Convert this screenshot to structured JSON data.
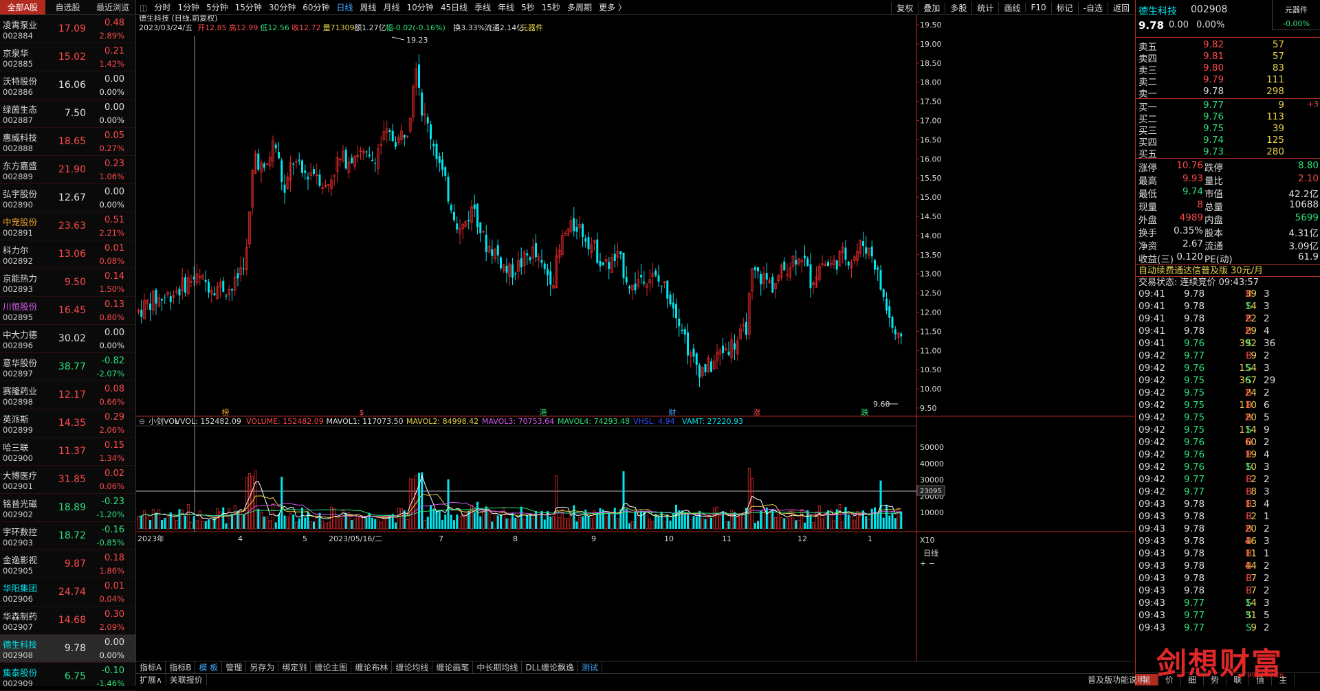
{
  "left_tabs": [
    "全部A股",
    "自选股",
    "最近浏览"
  ],
  "stocks": [
    {
      "name": "凌霄泵业",
      "code": "002884",
      "price": "17.09",
      "chg": "0.48",
      "pct": "2.89%",
      "dir": "up"
    },
    {
      "name": "京泉华",
      "code": "002885",
      "price": "15.02",
      "chg": "0.21",
      "pct": "1.42%",
      "dir": "up"
    },
    {
      "name": "沃特股份",
      "code": "002886",
      "price": "16.06",
      "chg": "0.00",
      "pct": "0.00%",
      "dir": "flat"
    },
    {
      "name": "绿茵生态",
      "code": "002887",
      "price": "7.50",
      "chg": "0.00",
      "pct": "0.00%",
      "dir": "flat"
    },
    {
      "name": "惠威科技",
      "code": "002888",
      "price": "18.65",
      "chg": "0.05",
      "pct": "0.27%",
      "dir": "up"
    },
    {
      "name": "东方嘉盛",
      "code": "002889",
      "price": "21.90",
      "chg": "0.23",
      "pct": "1.06%",
      "dir": "up"
    },
    {
      "name": "弘宇股份",
      "code": "002890",
      "price": "12.67",
      "chg": "0.00",
      "pct": "0.00%",
      "dir": "flat"
    },
    {
      "name": "中宠股份",
      "code": "002891",
      "price": "23.63",
      "chg": "0.51",
      "pct": "2.21%",
      "dir": "up",
      "nameColor": "#f0a030"
    },
    {
      "name": "科力尔",
      "code": "002892",
      "price": "13.06",
      "chg": "0.01",
      "pct": "0.08%",
      "dir": "up"
    },
    {
      "name": "京能热力",
      "code": "002893",
      "price": "9.50",
      "chg": "0.14",
      "pct": "1.50%",
      "dir": "up"
    },
    {
      "name": "川恒股份",
      "code": "002895",
      "price": "16.45",
      "chg": "0.13",
      "pct": "0.80%",
      "dir": "up",
      "nameColor": "#d85cf0"
    },
    {
      "name": "中大力德",
      "code": "002896",
      "price": "30.02",
      "chg": "0.00",
      "pct": "0.00%",
      "dir": "flat"
    },
    {
      "name": "意华股份",
      "code": "002897",
      "price": "38.77",
      "chg": "-0.82",
      "pct": "-2.07%",
      "dir": "down"
    },
    {
      "name": "赛隆药业",
      "code": "002898",
      "price": "12.17",
      "chg": "0.08",
      "pct": "0.66%",
      "dir": "up"
    },
    {
      "name": "英派斯",
      "code": "002899",
      "price": "14.35",
      "chg": "0.29",
      "pct": "2.06%",
      "dir": "up"
    },
    {
      "name": "哈三联",
      "code": "002900",
      "price": "11.37",
      "chg": "0.15",
      "pct": "1.34%",
      "dir": "up"
    },
    {
      "name": "大博医疗",
      "code": "002901",
      "price": "31.85",
      "chg": "0.02",
      "pct": "0.06%",
      "dir": "up"
    },
    {
      "name": "铭普光磁",
      "code": "002902",
      "price": "18.89",
      "chg": "-0.23",
      "pct": "-1.20%",
      "dir": "down"
    },
    {
      "name": "宇环数控",
      "code": "002903",
      "price": "18.72",
      "chg": "-0.16",
      "pct": "-0.85%",
      "dir": "down"
    },
    {
      "name": "金逸影视",
      "code": "002905",
      "price": "9.87",
      "chg": "0.18",
      "pct": "1.86%",
      "dir": "up"
    },
    {
      "name": "华阳集团",
      "code": "002906",
      "price": "24.74",
      "chg": "0.01",
      "pct": "0.04%",
      "dir": "up",
      "nameColor": "#00e5ee"
    },
    {
      "name": "华森制药",
      "code": "002907",
      "price": "14.68",
      "chg": "0.30",
      "pct": "2.09%",
      "dir": "up"
    },
    {
      "name": "德生科技",
      "code": "002908",
      "price": "9.78",
      "chg": "0.00",
      "pct": "0.00%",
      "dir": "flat",
      "nameColor": "#00e5ee",
      "selected": true
    },
    {
      "name": "集泰股份",
      "code": "002909",
      "price": "6.75",
      "chg": "-0.10",
      "pct": "-1.46%",
      "dir": "down",
      "nameColor": "#00e5ee"
    }
  ],
  "periods": [
    "分时",
    "1分钟",
    "5分钟",
    "15分钟",
    "30分钟",
    "60分钟",
    "日线",
    "周线",
    "月线",
    "10分钟",
    "45日线",
    "季线",
    "年线",
    "5秒",
    "15秒",
    "多周期",
    "更多 〉"
  ],
  "active_period": "日线",
  "top_right": [
    "复权",
    "叠加",
    "多股",
    "统计",
    "画线",
    "F10",
    "标记",
    "-自选",
    "返回"
  ],
  "chart_title": "德生科技 (日线,前复权)",
  "info": {
    "date": "2023/03/24/五",
    "open": "开12.85",
    "high": "高12.99",
    "low": "低12.56",
    "close": "收12.72",
    "vol": "量71309",
    "amt": "额1.27亿",
    "fu": "幅-0.02(-0.16%)",
    "huan": "换3.33%",
    "lt": "流通2.14亿",
    "tag": "元器件"
  },
  "price_axis": [
    "19.50",
    "19.00",
    "18.50",
    "18.00",
    "17.50",
    "17.00",
    "16.50",
    "16.00",
    "15.50",
    "15.00",
    "14.50",
    "14.00",
    "13.50",
    "13.00",
    "12.50",
    "12.00",
    "11.50",
    "11.00",
    "10.50",
    "10.00",
    "9.50"
  ],
  "high_mark": "19.23",
  "low_mark": "9.60",
  "event_markers": [
    {
      "label": "榜",
      "color": "#f0a030"
    },
    {
      "label": "$",
      "color": "#ff4a4a"
    },
    {
      "label": "港",
      "color": "#2ee07a"
    },
    {
      "label": "财",
      "color": "#3fa8ff"
    },
    {
      "label": "涨",
      "color": "#ff4a4a"
    },
    {
      "label": "跌",
      "color": "#2ee07a"
    }
  ],
  "vol_legend": {
    "name": "小剑VOL",
    "vvol": "VVOL: 152482.09",
    "volume": "VOLUME: 152482.09",
    "m1": "MAVOL1: 117073.50",
    "m2": "MAVOL2: 84998.42",
    "m3": "MAVOL3: 70753.64",
    "m4": "MAVOL4: 74293.48",
    "vhsl": "VHSL: 4.94",
    "vamt": "VAMT: 27220.93"
  },
  "vol_axis": [
    "50000",
    "40000",
    "30000",
    "20000",
    "10000"
  ],
  "vol_marker": "23095",
  "vol_unit": "X10",
  "date_axis": [
    "2023年",
    "4",
    "5",
    "2023/05/16/二",
    "7",
    "8",
    "9",
    "10",
    "11",
    "12",
    "1"
  ],
  "bottom_row1": [
    "指标A",
    "指标B",
    "模 板",
    "管理",
    "另存为",
    "绑定到",
    "缠论主图",
    "缠论布林",
    "缠论均线",
    "缠论画笔",
    "中长期均线",
    "DLL缠论飘逸",
    "测试"
  ],
  "bottom_row2": [
    "扩展∧",
    "关联报价"
  ],
  "right": {
    "name": "德生科技",
    "code": "002908",
    "price": "9.78",
    "chg": "0.00",
    "pct": "0.00%",
    "sector": "元器件",
    "sector_pct": "-0.00%",
    "sells": [
      {
        "l": "卖五",
        "p": "9.82",
        "v": "57"
      },
      {
        "l": "卖四",
        "p": "9.81",
        "v": "57"
      },
      {
        "l": "卖三",
        "p": "9.80",
        "v": "83"
      },
      {
        "l": "卖二",
        "p": "9.79",
        "v": "111"
      },
      {
        "l": "卖一",
        "p": "9.78",
        "v": "298"
      }
    ],
    "buys": [
      {
        "l": "买一",
        "p": "9.77",
        "v": "9",
        "x": "+3"
      },
      {
        "l": "买二",
        "p": "9.76",
        "v": "113"
      },
      {
        "l": "买三",
        "p": "9.75",
        "v": "39"
      },
      {
        "l": "买四",
        "p": "9.74",
        "v": "125"
      },
      {
        "l": "买五",
        "p": "9.73",
        "v": "280"
      }
    ],
    "stats": [
      {
        "a": "涨停",
        "av": "10.76",
        "ac": "red",
        "b": "跌停",
        "bv": "8.80",
        "bc": "green"
      },
      {
        "a": "最高",
        "av": "9.93",
        "ac": "red",
        "b": "量比",
        "bv": "2.10",
        "bc": "red"
      },
      {
        "a": "最低",
        "av": "9.74",
        "ac": "green",
        "b": "市值",
        "bv": "42.2亿",
        "bc": "white"
      },
      {
        "a": "现量",
        "av": "8",
        "ac": "red",
        "b": "总量",
        "bv": "10688",
        "bc": "white"
      },
      {
        "a": "外盘",
        "av": "4989",
        "ac": "red",
        "b": "内盘",
        "bv": "5699",
        "bc": "green"
      },
      {
        "a": "换手",
        "av": "0.35%",
        "ac": "white",
        "b": "股本",
        "bv": "4.31亿",
        "bc": "white"
      },
      {
        "a": "净资",
        "av": "2.67",
        "ac": "white",
        "b": "流通",
        "bv": "3.09亿",
        "bc": "white"
      },
      {
        "a": "收益(三)",
        "av": "0.120",
        "ac": "white",
        "b": "PE(动)",
        "bv": "61.9",
        "bc": "white"
      }
    ],
    "promo": "自动续费通达信普及版 30元/月",
    "trade_state": "交易状态: 连续竞价 09:43:57",
    "ticks": [
      [
        "09:41",
        "9.78",
        "39",
        "B",
        "3"
      ],
      [
        "09:41",
        "9.78",
        "14",
        "S",
        "3"
      ],
      [
        "09:41",
        "9.78",
        "22",
        "B",
        "2"
      ],
      [
        "09:41",
        "9.78",
        "29",
        "B",
        "4"
      ],
      [
        "09:41",
        "9.76",
        "392",
        "S",
        "36"
      ],
      [
        "09:42",
        "9.77",
        "9",
        "B",
        "2"
      ],
      [
        "09:42",
        "9.76",
        "154",
        "S",
        "3"
      ],
      [
        "09:42",
        "9.75",
        "367",
        "S",
        "29"
      ],
      [
        "09:42",
        "9.75",
        "24",
        "B",
        "2"
      ],
      [
        "09:42",
        "9.75",
        "110",
        "B",
        "6"
      ],
      [
        "09:42",
        "9.75",
        "20",
        "B",
        "5"
      ],
      [
        "09:42",
        "9.75",
        "114",
        "S",
        "9"
      ],
      [
        "09:42",
        "9.76",
        "60",
        "B",
        "2"
      ],
      [
        "09:42",
        "9.76",
        "19",
        "B",
        "4"
      ],
      [
        "09:42",
        "9.76",
        "10",
        "S",
        "3"
      ],
      [
        "09:42",
        "9.77",
        "2",
        "B",
        "2"
      ],
      [
        "09:42",
        "9.77",
        "8",
        "B",
        "3"
      ],
      [
        "09:43",
        "9.78",
        "13",
        "B",
        "4"
      ],
      [
        "09:43",
        "9.78",
        "2",
        "B",
        "1"
      ],
      [
        "09:43",
        "9.78",
        "20",
        "B",
        "2"
      ],
      [
        "09:43",
        "9.78",
        "46",
        "B",
        "3"
      ],
      [
        "09:43",
        "9.78",
        "11",
        "B",
        "1"
      ],
      [
        "09:43",
        "9.78",
        "44",
        "B",
        "2"
      ],
      [
        "09:43",
        "9.78",
        "7",
        "B",
        "2"
      ],
      [
        "09:43",
        "9.78",
        "7",
        "B",
        "2"
      ],
      [
        "09:43",
        "9.77",
        "14",
        "S",
        "3"
      ],
      [
        "09:43",
        "9.77",
        "31",
        "S",
        "5"
      ],
      [
        "09:43",
        "9.77",
        "9",
        "S",
        "2"
      ]
    ],
    "bottom_tabs": [
      "笔",
      "价",
      "细",
      "势",
      "联",
      "值",
      "主"
    ],
    "version": "普及版功能说明"
  },
  "watermark": "剑想财富",
  "watermark_url": "995168.cn",
  "colors": {
    "up": "#ff4a4a",
    "down": "#2ee07a",
    "flat": "#e0e0e0",
    "candle_up": "#e02828",
    "candle_down": "#00e5ee"
  }
}
